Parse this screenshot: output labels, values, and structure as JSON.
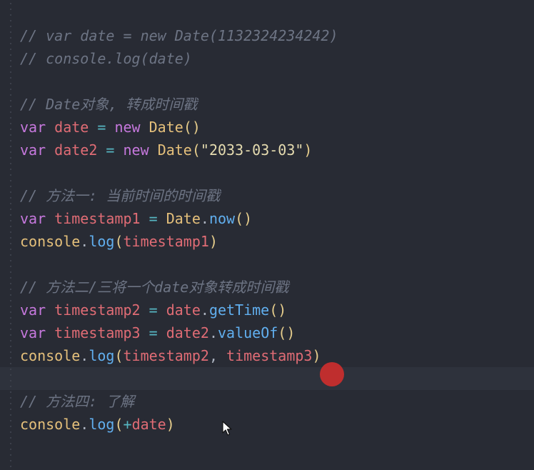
{
  "editor": {
    "lines": [
      {
        "tokens": [
          {
            "t": "// var date = new Date(1132324234242)",
            "k": "comment"
          }
        ]
      },
      {
        "tokens": [
          {
            "t": "// console.log(date)",
            "k": "comment"
          }
        ]
      },
      {
        "tokens": []
      },
      {
        "tokens": [
          {
            "t": "// Date对象, 转成时间戳",
            "k": "comment"
          }
        ]
      },
      {
        "tokens": [
          {
            "t": "var",
            "k": "kw"
          },
          {
            "t": " ",
            "k": "plain"
          },
          {
            "t": "date",
            "k": "var"
          },
          {
            "t": " = ",
            "k": "op"
          },
          {
            "t": "new",
            "k": "kw"
          },
          {
            "t": " ",
            "k": "plain"
          },
          {
            "t": "Date",
            "k": "cls"
          },
          {
            "t": "()",
            "k": "punc"
          }
        ]
      },
      {
        "tokens": [
          {
            "t": "var",
            "k": "kw"
          },
          {
            "t": " ",
            "k": "plain"
          },
          {
            "t": "date2",
            "k": "var"
          },
          {
            "t": " = ",
            "k": "op"
          },
          {
            "t": "new",
            "k": "kw"
          },
          {
            "t": " ",
            "k": "plain"
          },
          {
            "t": "Date",
            "k": "cls"
          },
          {
            "t": "(",
            "k": "punc"
          },
          {
            "t": "\"2033-03-03\"",
            "k": "str"
          },
          {
            "t": ")",
            "k": "punc"
          }
        ]
      },
      {
        "tokens": []
      },
      {
        "tokens": [
          {
            "t": "// 方法一: 当前时间的时间戳",
            "k": "comment"
          }
        ]
      },
      {
        "tokens": [
          {
            "t": "var",
            "k": "kw"
          },
          {
            "t": " ",
            "k": "plain"
          },
          {
            "t": "timestamp1",
            "k": "var"
          },
          {
            "t": " = ",
            "k": "op"
          },
          {
            "t": "Date",
            "k": "cls"
          },
          {
            "t": ".",
            "k": "plain"
          },
          {
            "t": "now",
            "k": "fn"
          },
          {
            "t": "()",
            "k": "punc"
          }
        ]
      },
      {
        "tokens": [
          {
            "t": "console",
            "k": "obj"
          },
          {
            "t": ".",
            "k": "plain"
          },
          {
            "t": "log",
            "k": "fn"
          },
          {
            "t": "(",
            "k": "punc"
          },
          {
            "t": "timestamp1",
            "k": "var"
          },
          {
            "t": ")",
            "k": "punc"
          }
        ]
      },
      {
        "tokens": []
      },
      {
        "tokens": [
          {
            "t": "// 方法二/三将一个date对象转成时间戳",
            "k": "comment"
          }
        ]
      },
      {
        "tokens": [
          {
            "t": "var",
            "k": "kw"
          },
          {
            "t": " ",
            "k": "plain"
          },
          {
            "t": "timestamp2",
            "k": "var"
          },
          {
            "t": " = ",
            "k": "op"
          },
          {
            "t": "date",
            "k": "var"
          },
          {
            "t": ".",
            "k": "plain"
          },
          {
            "t": "getTime",
            "k": "fn"
          },
          {
            "t": "()",
            "k": "punc"
          }
        ]
      },
      {
        "tokens": [
          {
            "t": "var",
            "k": "kw"
          },
          {
            "t": " ",
            "k": "plain"
          },
          {
            "t": "timestamp3",
            "k": "var"
          },
          {
            "t": " = ",
            "k": "op"
          },
          {
            "t": "date2",
            "k": "var"
          },
          {
            "t": ".",
            "k": "plain"
          },
          {
            "t": "valueOf",
            "k": "fn"
          },
          {
            "t": "()",
            "k": "punc"
          }
        ]
      },
      {
        "tokens": [
          {
            "t": "console",
            "k": "obj"
          },
          {
            "t": ".",
            "k": "plain"
          },
          {
            "t": "log",
            "k": "fn"
          },
          {
            "t": "(",
            "k": "punc"
          },
          {
            "t": "timestamp2",
            "k": "var"
          },
          {
            "t": ", ",
            "k": "plain"
          },
          {
            "t": "timestamp3",
            "k": "var"
          },
          {
            "t": ")",
            "k": "punc"
          }
        ]
      },
      {
        "tokens": []
      },
      {
        "tokens": [
          {
            "t": "// 方法四: 了解",
            "k": "comment"
          }
        ]
      },
      {
        "tokens": [
          {
            "t": "console",
            "k": "obj"
          },
          {
            "t": ".",
            "k": "plain"
          },
          {
            "t": "log",
            "k": "fn"
          },
          {
            "t": "(",
            "k": "punc"
          },
          {
            "t": "+",
            "k": "op"
          },
          {
            "t": "date",
            "k": "var"
          },
          {
            "t": ")",
            "k": "punc"
          }
        ]
      }
    ],
    "current_line_index": 15,
    "colors": {
      "background": "#282b34",
      "comment": "#6d7484",
      "keyword": "#c678dd",
      "variable": "#e06c75",
      "operator": "#56b6c2",
      "class": "#e5c07b",
      "function": "#61afef",
      "string": "#e6dcb0",
      "click_marker": "#cc2e2e"
    }
  },
  "overlay": {
    "click_marker_icon": "click-indicator-icon",
    "mouse_pointer_icon": "mouse-pointer-icon"
  }
}
